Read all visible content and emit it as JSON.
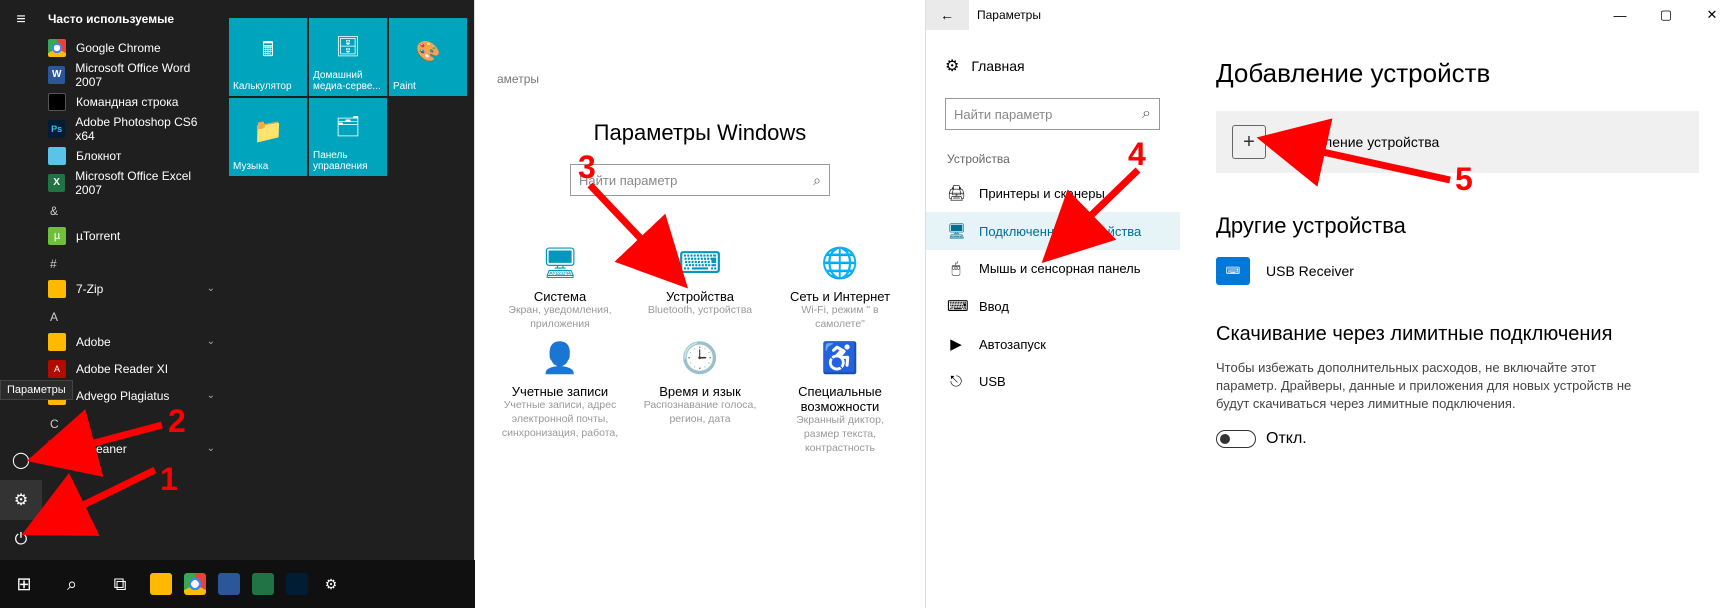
{
  "annotations": {
    "n1": "1",
    "n2": "2",
    "n3": "3",
    "n4": "4",
    "n5": "5"
  },
  "start": {
    "frequent_header": "Часто используемые",
    "settings_tooltip": "Параметры",
    "apps_frequent": [
      "Google Chrome",
      "Microsoft Office Word 2007",
      "Командная строка",
      "Adobe Photoshop CS6 x64",
      "Блокнот",
      "Microsoft Office Excel 2007"
    ],
    "section_amp": "&",
    "app_ut": "µTorrent",
    "section_hash": "#",
    "app_7zip": "7-Zip",
    "section_A": "A",
    "app_adobe": "Adobe",
    "app_reader": "Adobe Reader XI",
    "app_advego": "Advego Plagiatus",
    "section_C": "C",
    "app_ccleaner": "CCleaner",
    "tiles": {
      "calc": "Калькулятор",
      "media": "Домашний медиа-серве...",
      "paint": "Paint",
      "music": "Музыка",
      "panel": "Панель управления"
    }
  },
  "mid": {
    "breadcrumb": "аметры",
    "title": "Параметры Windows",
    "search_placeholder": "Найти параметр",
    "cats": {
      "system": {
        "name": "Система",
        "desc": "Экран, уведомления, приложения"
      },
      "devices": {
        "name": "Устройства",
        "desc": "Bluetooth, устройства"
      },
      "network": {
        "name": "Сеть и Интернет",
        "desc": "Wi-Fi, режим \" в самолете\""
      },
      "accounts": {
        "name": "Учетные записи",
        "desc": "Учетные записи, адрес электронной почты, синхронизация, работа,"
      },
      "time": {
        "name": "Время и язык",
        "desc": "Распознавание голоса, регион, дата"
      },
      "ease": {
        "name": "Специальные возможности",
        "desc": "Экранный диктор, размер текста, контрастность"
      }
    }
  },
  "right": {
    "window_title": "Параметры",
    "home": "Главная",
    "search_placeholder": "Найти параметр",
    "section": "Устройства",
    "nav": {
      "printers": "Принтеры и сканеры",
      "connected": "Подключенные устройства",
      "mouse": "Мышь и сенсорная панель",
      "input": "Ввод",
      "autoplay": "Автозапуск",
      "usb": "USB"
    },
    "content": {
      "h1": "Добавление устройств",
      "add_label": "Добавление устройства",
      "h2": "Другие устройства",
      "device1": "USB Receiver",
      "h3": "Скачивание через лимитные подключения",
      "para": "Чтобы избежать дополнительных расходов, не включайте этот параметр. Драйверы, данные и приложения для новых устройств не будут скачиваться через лимитные подключения.",
      "toggle_label": "Откл."
    }
  }
}
